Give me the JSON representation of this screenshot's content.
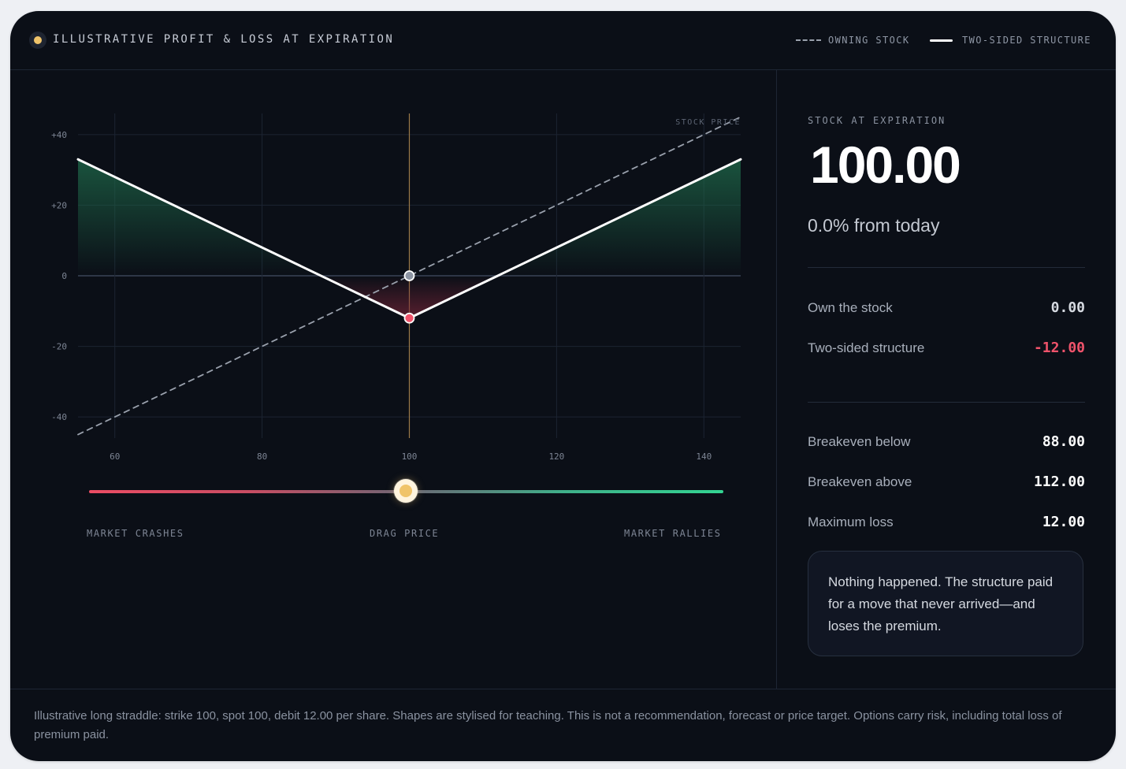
{
  "header": {
    "title": "ILLUSTRATIVE PROFIT & LOSS AT EXPIRATION",
    "legend": [
      {
        "label": "OWNING STOCK",
        "style": "dashed"
      },
      {
        "label": "TWO-SIDED STRUCTURE",
        "style": "solid"
      }
    ]
  },
  "chart_data": {
    "type": "line",
    "series": [
      {
        "name": "OWNING STOCK",
        "style": "dashed",
        "color": "#9aa1ad",
        "x": [
          55,
          145
        ],
        "y": [
          -45,
          45
        ]
      },
      {
        "name": "TWO-SIDED STRUCTURE",
        "style": "solid",
        "color": "#ffffff",
        "x": [
          55,
          100,
          145
        ],
        "y": [
          33,
          -12,
          33
        ]
      }
    ],
    "x_ticks": [
      "60",
      "80",
      "100",
      "120",
      "140"
    ],
    "x_tick_values": [
      60,
      80,
      100,
      120,
      140
    ],
    "y_ticks": [
      "+40",
      "+20",
      "0",
      "-20",
      "-40"
    ],
    "y_tick_values": [
      40,
      20,
      0,
      -20,
      -40
    ],
    "xlim": [
      55,
      145
    ],
    "ylim": [
      -46,
      46
    ],
    "annotation": "STOCK PRICE",
    "current_price": 100,
    "markers": [
      {
        "series": "OWNING STOCK",
        "x": 100,
        "y": 0,
        "color": "#8d95a3"
      },
      {
        "series": "TWO-SIDED STRUCTURE",
        "x": 100,
        "y": -12,
        "color": "#f0536b"
      }
    ],
    "profit_color": "#1f6b4b",
    "loss_color": "#7a2639",
    "grid": true
  },
  "slider": {
    "left_label": "MARKET CRASHES",
    "center_label": "DRAG PRICE",
    "right_label": "MARKET RALLIES",
    "value_fraction": 0.5
  },
  "panel": {
    "label": "STOCK AT EXPIRATION",
    "price": "100.00",
    "change": "0.0% from today",
    "rows_top": [
      {
        "label": "Own the stock",
        "value": "0.00",
        "tone": "muted"
      },
      {
        "label": "Two-sided structure",
        "value": "-12.00",
        "tone": "neg"
      }
    ],
    "rows_bottom": [
      {
        "label": "Breakeven below",
        "value": "88.00"
      },
      {
        "label": "Breakeven above",
        "value": "112.00"
      },
      {
        "label": "Maximum loss",
        "value": "12.00"
      }
    ],
    "note": "Nothing happened. The structure paid for a move that never arrived—and loses the premium."
  },
  "footer": {
    "disclaimer": "Illustrative long straddle: strike 100, spot 100, debit 12.00 per share. Shapes are stylised for teaching. This is not a recommendation, forecast or price target. Options carry risk, including total loss of premium paid."
  },
  "colors": {
    "background": "#0b0f17",
    "accent": "#f0c46a",
    "negative": "#f0536b",
    "positive": "#33d492"
  }
}
